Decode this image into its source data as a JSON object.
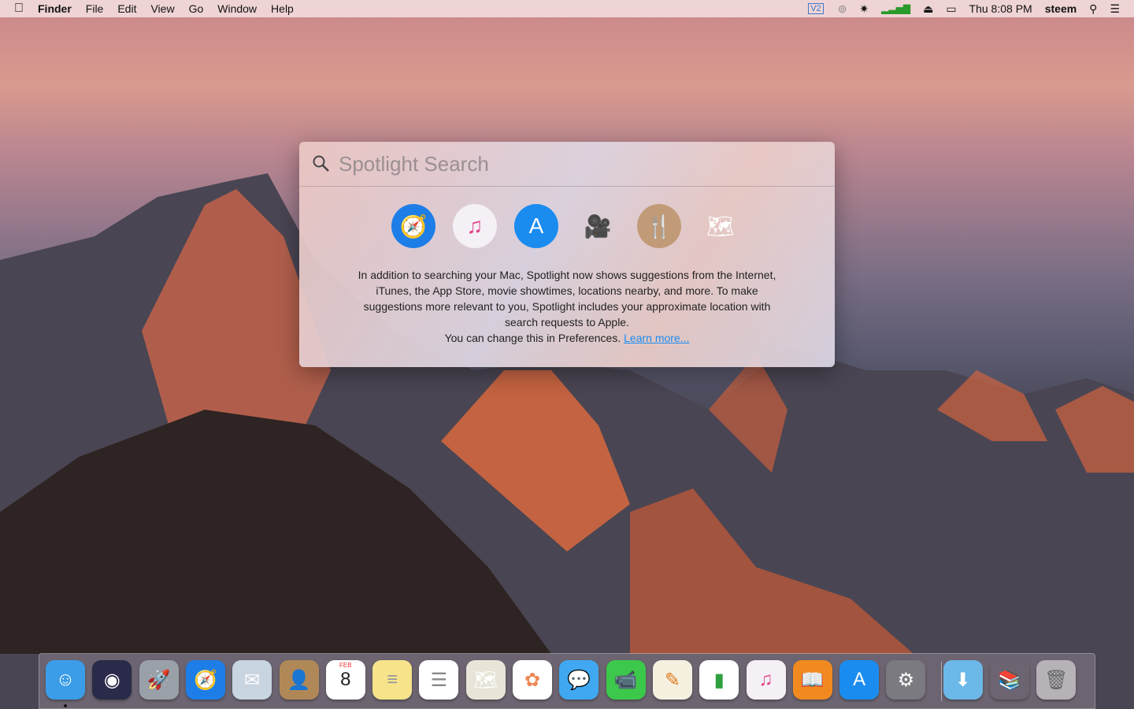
{
  "menubar": {
    "apple": "",
    "app": "Finder",
    "items": [
      "File",
      "Edit",
      "View",
      "Go",
      "Window",
      "Help"
    ],
    "status": {
      "vpn": "V2",
      "clock": "Thu 8:08 PM",
      "user": "steem"
    }
  },
  "spotlight": {
    "placeholder": "Spotlight Search",
    "icons": [
      {
        "name": "safari-icon",
        "glyph": "🧭",
        "bg": "#1e7ee8"
      },
      {
        "name": "itunes-icon",
        "glyph": "♫",
        "bg": "#f4f0f6",
        "fg": "#e0448a"
      },
      {
        "name": "app-store-icon",
        "glyph": "A",
        "bg": "#1a8cf0"
      },
      {
        "name": "movie-camera-icon",
        "glyph": "🎥",
        "bg": "transparent",
        "fg": "#777"
      },
      {
        "name": "restaurant-icon",
        "glyph": "🍴",
        "bg": "#c19b78"
      },
      {
        "name": "maps-icon",
        "glyph": "🗺",
        "bg": "transparent"
      }
    ],
    "description": "In addition to searching your Mac, Spotlight now shows suggestions from the Internet, iTunes, the App Store, movie showtimes, locations nearby, and more. To make suggestions more relevant to you, Spotlight includes your approximate location with search requests to Apple.",
    "prefs_text": "You can change this in Preferences.",
    "learn_more": "Learn more..."
  },
  "dock": {
    "items": [
      {
        "name": "finder",
        "glyph": "☺",
        "bg": "#3b9de8",
        "running": true
      },
      {
        "name": "siri",
        "glyph": "◉",
        "bg": "#2a2a4a"
      },
      {
        "name": "launchpad",
        "glyph": "🚀",
        "bg": "#9aa0a8"
      },
      {
        "name": "safari",
        "glyph": "🧭",
        "bg": "#1e7ee8"
      },
      {
        "name": "mail",
        "glyph": "✉",
        "bg": "#c8d4e0"
      },
      {
        "name": "contacts",
        "glyph": "👤",
        "bg": "#b08858"
      },
      {
        "name": "calendar",
        "glyph": "8",
        "bg": "#ffffff",
        "fg": "#222",
        "label": "FEB"
      },
      {
        "name": "notes",
        "glyph": "≡",
        "bg": "#f7e48a",
        "fg": "#999"
      },
      {
        "name": "reminders",
        "glyph": "☰",
        "bg": "#ffffff",
        "fg": "#888"
      },
      {
        "name": "maps",
        "glyph": "🗺",
        "bg": "#e8e4d8"
      },
      {
        "name": "photos",
        "glyph": "✿",
        "bg": "#ffffff",
        "fg": "#e85"
      },
      {
        "name": "messages",
        "glyph": "💬",
        "bg": "#3fa8f0"
      },
      {
        "name": "facetime",
        "glyph": "📹",
        "bg": "#3cc84a"
      },
      {
        "name": "pages",
        "glyph": "✎",
        "bg": "#f5f0e0",
        "fg": "#e07a20"
      },
      {
        "name": "numbers",
        "glyph": "▮",
        "bg": "#ffffff",
        "fg": "#2fa040"
      },
      {
        "name": "itunes",
        "glyph": "♫",
        "bg": "#f4f0f6",
        "fg": "#e0448a"
      },
      {
        "name": "ibooks",
        "glyph": "📖",
        "bg": "#f08a20"
      },
      {
        "name": "app-store",
        "glyph": "A",
        "bg": "#1a8cf0"
      },
      {
        "name": "system-preferences",
        "glyph": "⚙",
        "bg": "#7a7a80"
      },
      {
        "name": "downloads",
        "glyph": "⬇",
        "bg": "#6cb8e8"
      },
      {
        "name": "calibre",
        "glyph": "📚",
        "bg": "transparent"
      },
      {
        "name": "trash",
        "glyph": "🗑",
        "bg": "rgba(255,255,255,.5)",
        "fg": "#666"
      }
    ]
  }
}
